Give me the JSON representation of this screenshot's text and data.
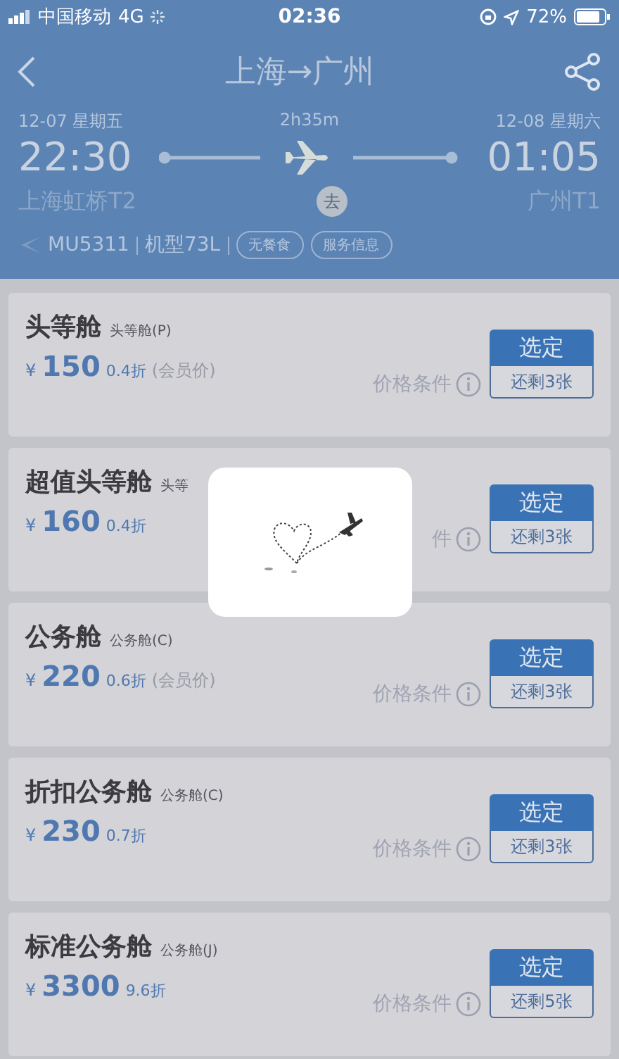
{
  "status_bar": {
    "carrier": "中国移动",
    "network": "4G",
    "time": "02:36",
    "battery": "72%"
  },
  "nav": {
    "title": "上海→广州"
  },
  "flight": {
    "dep_date": "12-07 星期五",
    "duration": "2h35m",
    "arr_date": "12-08 星期六",
    "dep_time": "22:30",
    "arr_time": "01:05",
    "dep_airport": "上海虹桥T2",
    "trip": "去",
    "arr_airport": "广州T1",
    "flight_no": "MU5311",
    "aircraft": "机型73L",
    "tags": [
      "无餐食",
      "服务信息"
    ]
  },
  "cabins": [
    {
      "name": "头等舱",
      "code": "头等舱(P)",
      "currency": "¥",
      "price": "150",
      "discount": "0.4折",
      "note": "(会员价)",
      "condition": "价格条件",
      "select": "选定",
      "remaining": "还剩3张"
    },
    {
      "name": "超值头等舱",
      "code": "头等",
      "currency": "¥",
      "price": "160",
      "discount": "0.4折",
      "condition": "件",
      "select": "选定",
      "remaining": "还剩3张"
    },
    {
      "name": "公务舱",
      "code": "公务舱(C)",
      "currency": "¥",
      "price": "220",
      "discount": "0.6折",
      "note": "(会员价)",
      "condition": "价格条件",
      "select": "选定",
      "remaining": "还剩3张"
    },
    {
      "name": "折扣公务舱",
      "code": "公务舱(C)",
      "currency": "¥",
      "price": "230",
      "discount": "0.7折",
      "condition": "价格条件",
      "select": "选定",
      "remaining": "还剩3张"
    },
    {
      "name": "标准公务舱",
      "code": "公务舱(J)",
      "currency": "¥",
      "price": "3300",
      "discount": "9.6折",
      "condition": "价格条件",
      "select": "选定",
      "remaining": "还剩5张"
    }
  ]
}
